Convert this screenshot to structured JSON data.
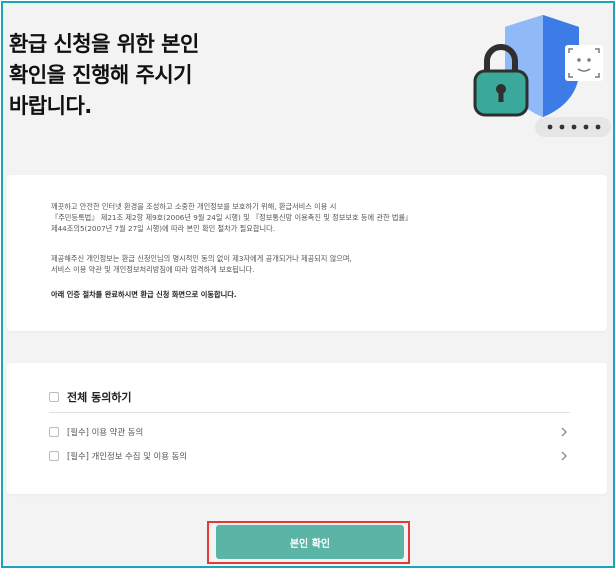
{
  "heading": "환급 신청을 위한 본인\n확인을 진행해 주시기\n바랍니다.",
  "notice": {
    "paragraph1": "깨끗하고 안전한 인터넷 환경을 조성하고 소중한 개인정보를 보호하기 위해, 환급서비스 이용 시\n『주민등록법』 제21조 제2항 제9호(2006년 9월 24일 시행) 및 『정보통신망 이용촉진 및 정보보호 등에 관한 법률』\n제44조의5(2007년 7월 27일 시행)에 따라 본인 확인 절차가 필요합니다.",
    "paragraph2": "제공해주신 개인정보는 환급 신청인님의 명시적인 동의 없이 제3자에게 공개되거나 제공되지 않으며,\n서비스 이용 약관 및 개인정보처리방침에 따라 엄격하게 보호됩니다.",
    "paragraph3": "아래 인증 절차를 완료하시면 환급 신청 화면으로 이동합니다."
  },
  "agreement": {
    "all_label": "전체 동의하기",
    "terms": [
      {
        "label": "[필수] 이용 약관 동의"
      },
      {
        "label": "[필수] 개인정보 수집 및 이용 동의"
      }
    ]
  },
  "cta": {
    "label": "본인 확인"
  },
  "colors": {
    "accent": "#5bb5a6",
    "frame": "#1aa5b8",
    "highlight": "#e53935",
    "shield": "#4f8ef0",
    "lock": "#3aa89a"
  },
  "icons": [
    "shield-icon",
    "padlock-icon",
    "face-scan-icon",
    "password-dots-icon",
    "chevron-right-icon",
    "checkbox-icon"
  ]
}
